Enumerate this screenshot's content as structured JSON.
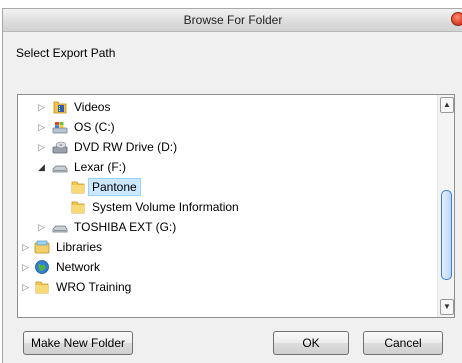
{
  "window": {
    "title": "Browse For Folder"
  },
  "instruction": "Select Export Path",
  "tree": {
    "items": [
      {
        "label": "Videos",
        "icon": "videos-folder-icon"
      },
      {
        "label": "OS (C:)",
        "icon": "windows-drive-icon"
      },
      {
        "label": "DVD RW Drive (D:)",
        "icon": "dvd-drive-icon"
      },
      {
        "label": "Lexar (F:)",
        "icon": "removable-drive-icon"
      },
      {
        "label": "Pantone",
        "icon": "folder-icon"
      },
      {
        "label": "System Volume Information",
        "icon": "folder-icon"
      },
      {
        "label": "TOSHIBA EXT (G:)",
        "icon": "external-drive-icon"
      },
      {
        "label": "Libraries",
        "icon": "libraries-icon"
      },
      {
        "label": "Network",
        "icon": "network-icon"
      },
      {
        "label": "WRO Training",
        "icon": "folder-icon"
      }
    ],
    "selected": "Pantone"
  },
  "buttons": {
    "make_new_folder": "Make New Folder",
    "ok": "OK",
    "cancel": "Cancel"
  }
}
